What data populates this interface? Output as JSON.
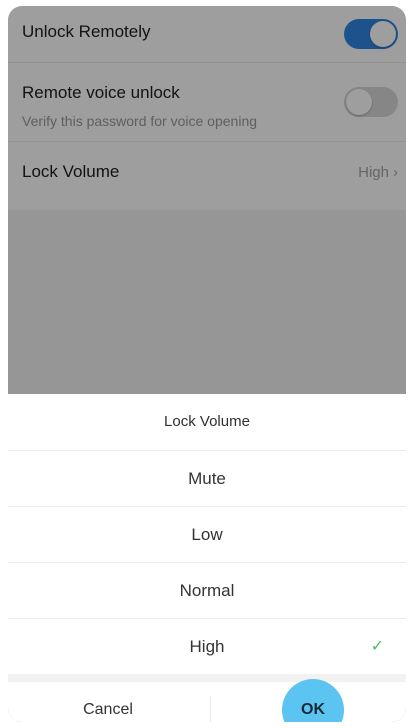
{
  "settings": {
    "unlock_remotely": {
      "label": "Unlock Remotely",
      "enabled": true
    },
    "remote_voice_unlock": {
      "label": "Remote voice unlock",
      "sublabel": "Verify this password for voice opening",
      "enabled": false
    },
    "lock_volume": {
      "label": "Lock Volume",
      "value": "High",
      "chevron": "›"
    }
  },
  "sheet": {
    "title": "Lock Volume",
    "options": [
      {
        "label": "Mute",
        "selected": false
      },
      {
        "label": "Low",
        "selected": false
      },
      {
        "label": "Normal",
        "selected": false
      },
      {
        "label": "High",
        "selected": true
      }
    ],
    "check_glyph": "✓",
    "cancel_label": "Cancel",
    "ok_label": "OK"
  },
  "colors": {
    "toggle_on": "#2f86e4",
    "toggle_off": "#d9d9d9",
    "check": "#4cbe6c",
    "ok_highlight": "#5cc4f0"
  }
}
